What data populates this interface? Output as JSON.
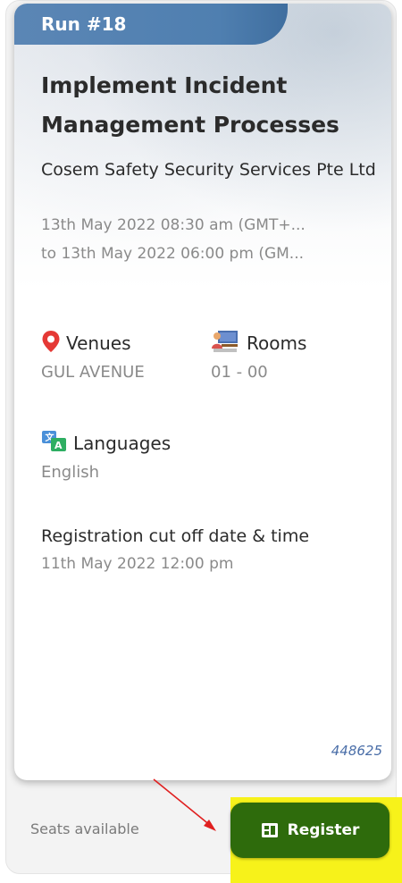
{
  "card": {
    "run_label": "Run #18",
    "title": "Implement Incident Management Processes",
    "organization": "Cosem Safety Security Services Pte Ltd",
    "date_start": "13th May 2022 08:30 am (GMT+...",
    "date_end": "to 13th May 2022 06:00 pm (GM...",
    "venues": {
      "label": "Venues",
      "value": "GUL AVENUE",
      "icon": "location-pin-icon"
    },
    "rooms": {
      "label": "Rooms",
      "value": "01 - 00",
      "icon": "rooms-icon"
    },
    "languages": {
      "label": "Languages",
      "value": "English",
      "icon": "languages-icon"
    },
    "registration": {
      "label": "Registration cut off date & time",
      "value": "11th May 2022 12:00 pm"
    },
    "code": "448625"
  },
  "footer": {
    "seats_label": "Seats available",
    "register_label": "Register"
  },
  "colors": {
    "badge": "#4f7fb0",
    "register_button": "#2e6b0c",
    "highlight": "#f7f21a",
    "pin": "#e53935",
    "annotation_arrow": "#e02020"
  }
}
